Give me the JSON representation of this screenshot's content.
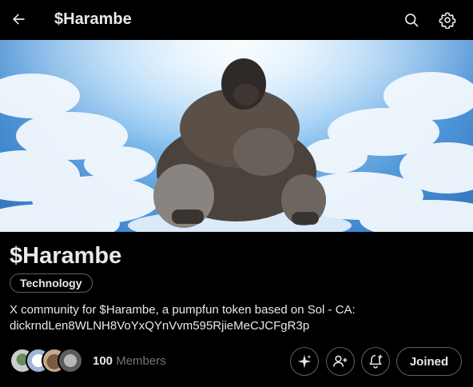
{
  "header": {
    "title": "$Harambe",
    "back_icon": "arrow-left-icon",
    "search_icon": "search-icon",
    "settings_icon": "gear-icon"
  },
  "community": {
    "name": "$Harambe",
    "topic": "Technology",
    "description_line1": "X community for $Harambe, a pumpfun token based on Sol - CA:",
    "description_line2": "dickrndLen8WLNH8VoYxQYnVvm595RjieMeCJCFgR3p",
    "member_count": "100",
    "members_label": " Members"
  },
  "actions": {
    "grok_icon": "sparkle-icon",
    "invite_icon": "add-user-icon",
    "create_icon": "new-post-icon",
    "joined_label": "Joined"
  },
  "colors": {
    "background": "#000000",
    "text": "#e7e9ea",
    "muted": "#71767b",
    "border": "#536471"
  }
}
